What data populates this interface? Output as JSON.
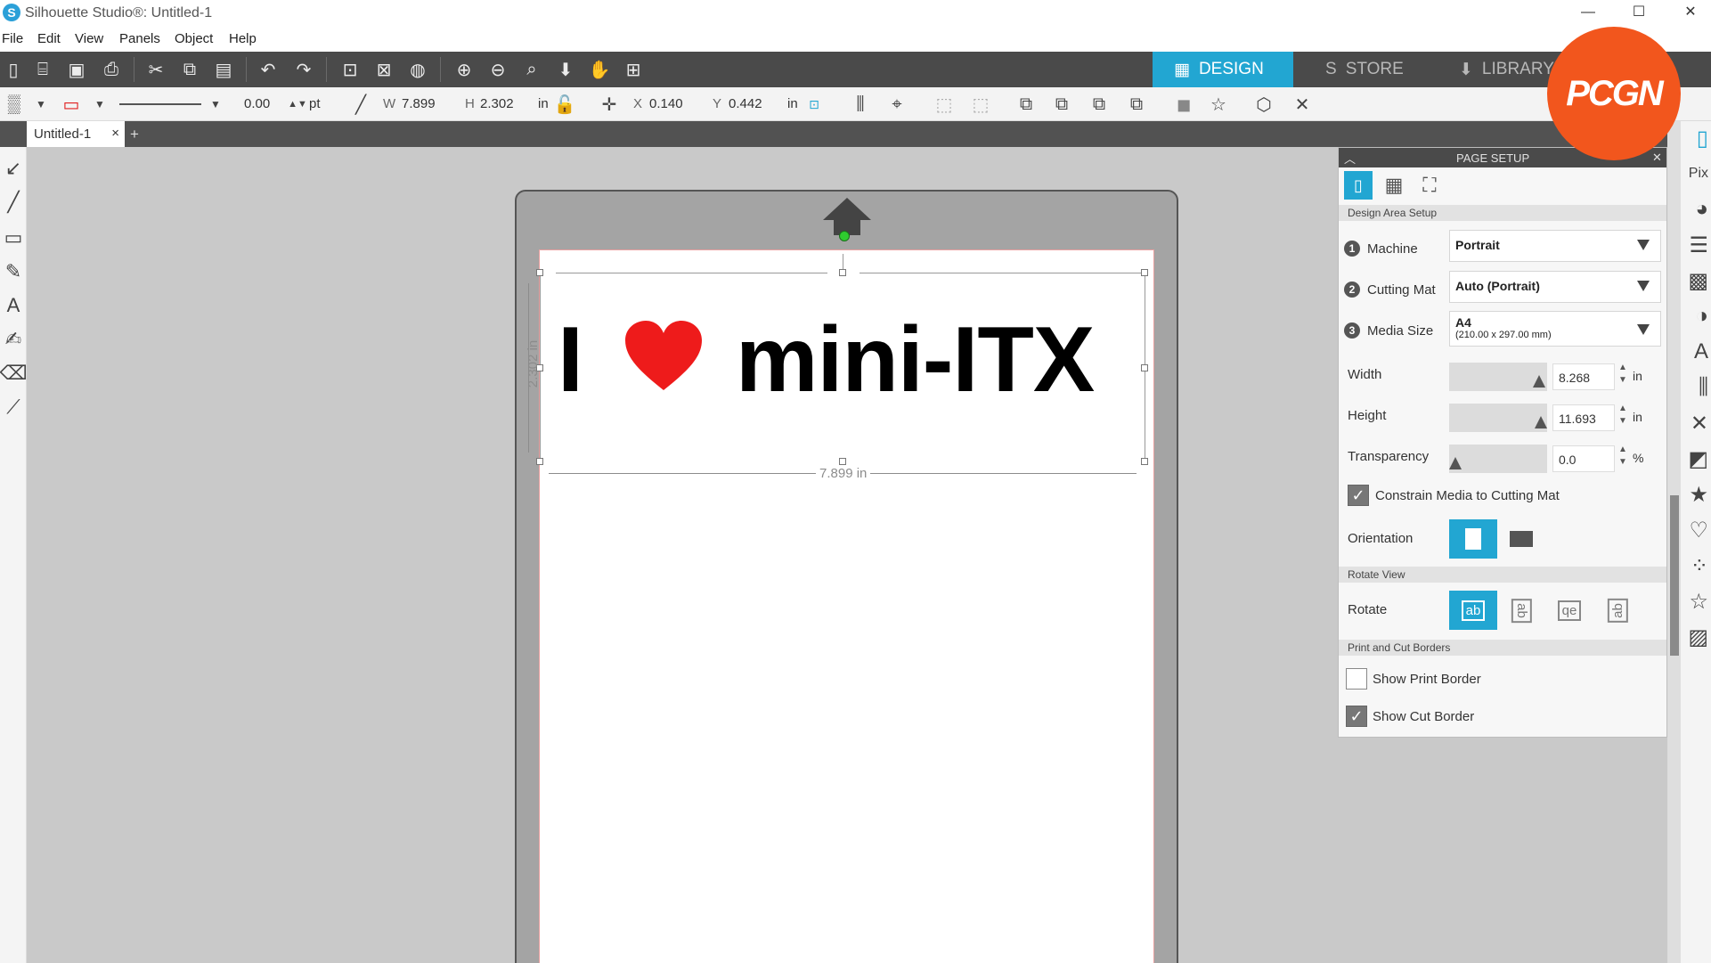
{
  "app": {
    "title": "Silhouette Studio®: Untitled-1"
  },
  "menu": [
    "File",
    "Edit",
    "View",
    "Panels",
    "Object",
    "Help"
  ],
  "nav_tabs": {
    "design": "DESIGN",
    "store": "STORE",
    "library": "LIBRARY"
  },
  "toolbar2": {
    "line_weight": "0.00",
    "line_unit": "pt",
    "w_label": "W",
    "w_value": "7.899",
    "h_label": "H",
    "h_value": "2.302",
    "size_unit": "in",
    "x_label": "X",
    "x_value": "0.140",
    "y_label": "Y",
    "y_value": "0.442",
    "pos_unit": "in"
  },
  "document": {
    "tab_label": "Untitled-1",
    "close": "×",
    "add": "+"
  },
  "design": {
    "text_i": "I",
    "text_mini": "mini-ITX",
    "height_dim": "2.302 in",
    "width_dim": "7.899 in",
    "heart_color": "#ee1b1b"
  },
  "panel": {
    "title": "PAGE SETUP",
    "section_design_area": "Design Area Setup",
    "machine_label": "Machine",
    "machine_value": "Portrait",
    "cutting_mat_label": "Cutting Mat",
    "cutting_mat_value": "Auto (Portrait)",
    "media_size_label": "Media Size",
    "media_size_value": "A4",
    "media_size_sub": "(210.00 x 297.00 mm)",
    "width_label": "Width",
    "width_value": "8.268",
    "width_unit": "in",
    "height_label": "Height",
    "height_value": "11.693",
    "height_unit": "in",
    "transparency_label": "Transparency",
    "transparency_value": "0.0",
    "transparency_unit": "%",
    "constrain_label": "Constrain Media to Cutting Mat",
    "orientation_label": "Orientation",
    "section_rotate": "Rotate View",
    "rotate_label": "Rotate",
    "rotate_options": [
      "ab",
      "ab",
      "qe",
      "ab"
    ],
    "section_borders": "Print and Cut Borders",
    "show_print_border": "Show Print Border",
    "show_cut_border": "Show Cut Border"
  },
  "watermark": {
    "logo_text": "PCGN"
  },
  "colors": {
    "accent": "#22a6d2",
    "toolbar_dark": "#4a4a4a",
    "badge": "#f2561d"
  }
}
